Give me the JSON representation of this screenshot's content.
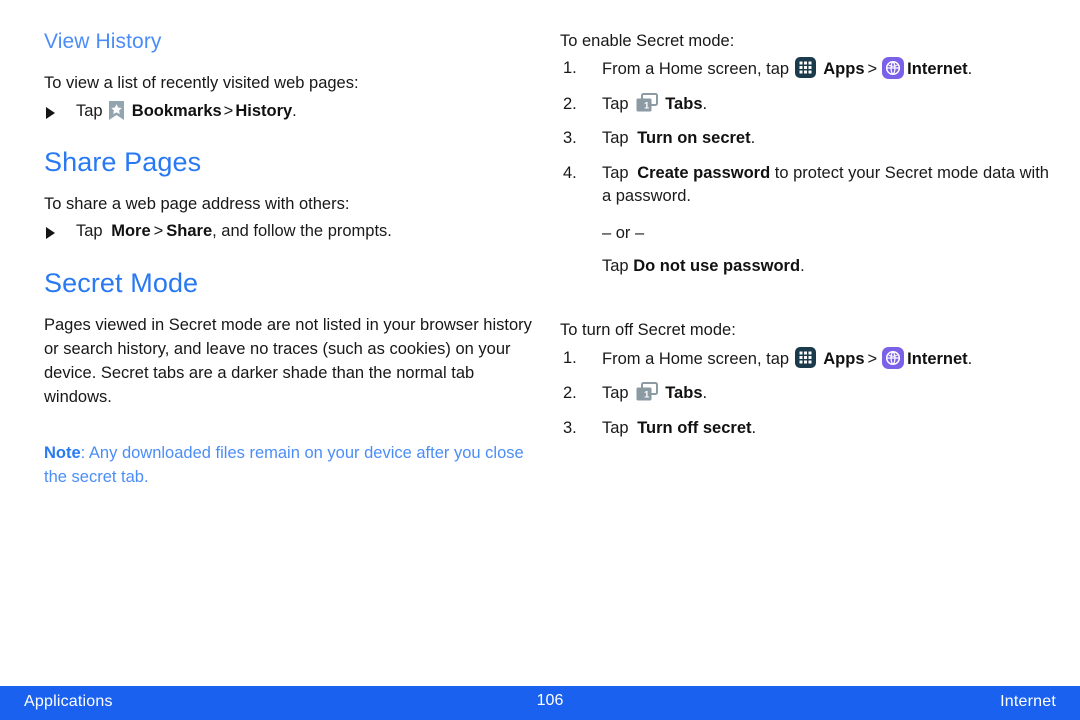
{
  "document": {
    "left_column": {
      "view_history": {
        "heading": "View History",
        "intro": "To view a list of recently visited web pages:",
        "bullet": {
          "prefix": "Tap",
          "icon": "bookmark-icon",
          "bold_1": "Bookmarks",
          "separator": ">",
          "bold_2": "History",
          "suffix": "."
        }
      },
      "share_pages": {
        "heading": "Share Pages",
        "intro": "To share a web page address with others:",
        "bullet": {
          "prefix": "Tap",
          "bold_1": "More",
          "separator": ">",
          "bold_2": "Share",
          "suffix": ", and follow the prompts."
        }
      },
      "secret_mode": {
        "heading": "Secret Mode",
        "paragraph": "Pages viewed in Secret mode are not listed in your browser history or search history, and leave no traces (such as cookies) on your device. Secret tabs are a darker shade than the normal tab windows.",
        "note_label": "Note",
        "note_text": ": Any downloaded files remain on your device after you close the secret tab."
      }
    },
    "right_column": {
      "enable_secret": {
        "intro": "To enable Secret mode:",
        "steps": [
          {
            "number": "1.",
            "text_before": "From a Home screen, tap",
            "icon_1": "apps-grid-icon",
            "bold_1": "Apps",
            "separator": ">",
            "icon_2": "internet-globe-icon",
            "bold_2": "Internet",
            "text_after": "."
          },
          {
            "number": "2.",
            "text_before": "Tap",
            "icon_1": "tabs-icon",
            "bold_1": "Tabs",
            "text_after": "."
          },
          {
            "number": "3.",
            "text_before": "Tap",
            "bold_1": "Turn on secret",
            "text_after": "."
          },
          {
            "number": "4.",
            "text_before": "Tap",
            "bold_1": "Create password",
            "text_after": " to protect your Secret mode data with a password.",
            "or_line": "– or –",
            "alt_before": "Tap",
            "alt_bold": "Do not use password",
            "alt_after": "."
          }
        ]
      },
      "turn_off_secret": {
        "intro": "To turn off Secret mode:",
        "steps": [
          {
            "number": "1.",
            "text_before": "From a Home screen, tap",
            "icon_1": "apps-grid-icon",
            "bold_1": "Apps",
            "separator": ">",
            "icon_2": "internet-globe-icon",
            "bold_2": "Internet",
            "text_after": "."
          },
          {
            "number": "2.",
            "text_before": "Tap",
            "icon_1": "tabs-icon",
            "bold_1": "Tabs",
            "text_after": "."
          },
          {
            "number": "3.",
            "text_before": "Tap",
            "bold_1": "Turn off secret",
            "text_after": "."
          }
        ]
      }
    },
    "footer": {
      "left": "Applications",
      "page_number": "106",
      "right": "Internet"
    },
    "colors": {
      "heading_primary": "#2979f2",
      "heading_secondary": "#4b8df8",
      "note_text": "#4b8df8",
      "footer_bar": "#1a61f0",
      "apps_icon": "#1b3a4b",
      "internet_icon": "#7b61e8",
      "tabs_icon": "#8b9aa3",
      "bookmark_icon": "#93a6b0"
    },
    "tabs_icon_badge": "1"
  }
}
